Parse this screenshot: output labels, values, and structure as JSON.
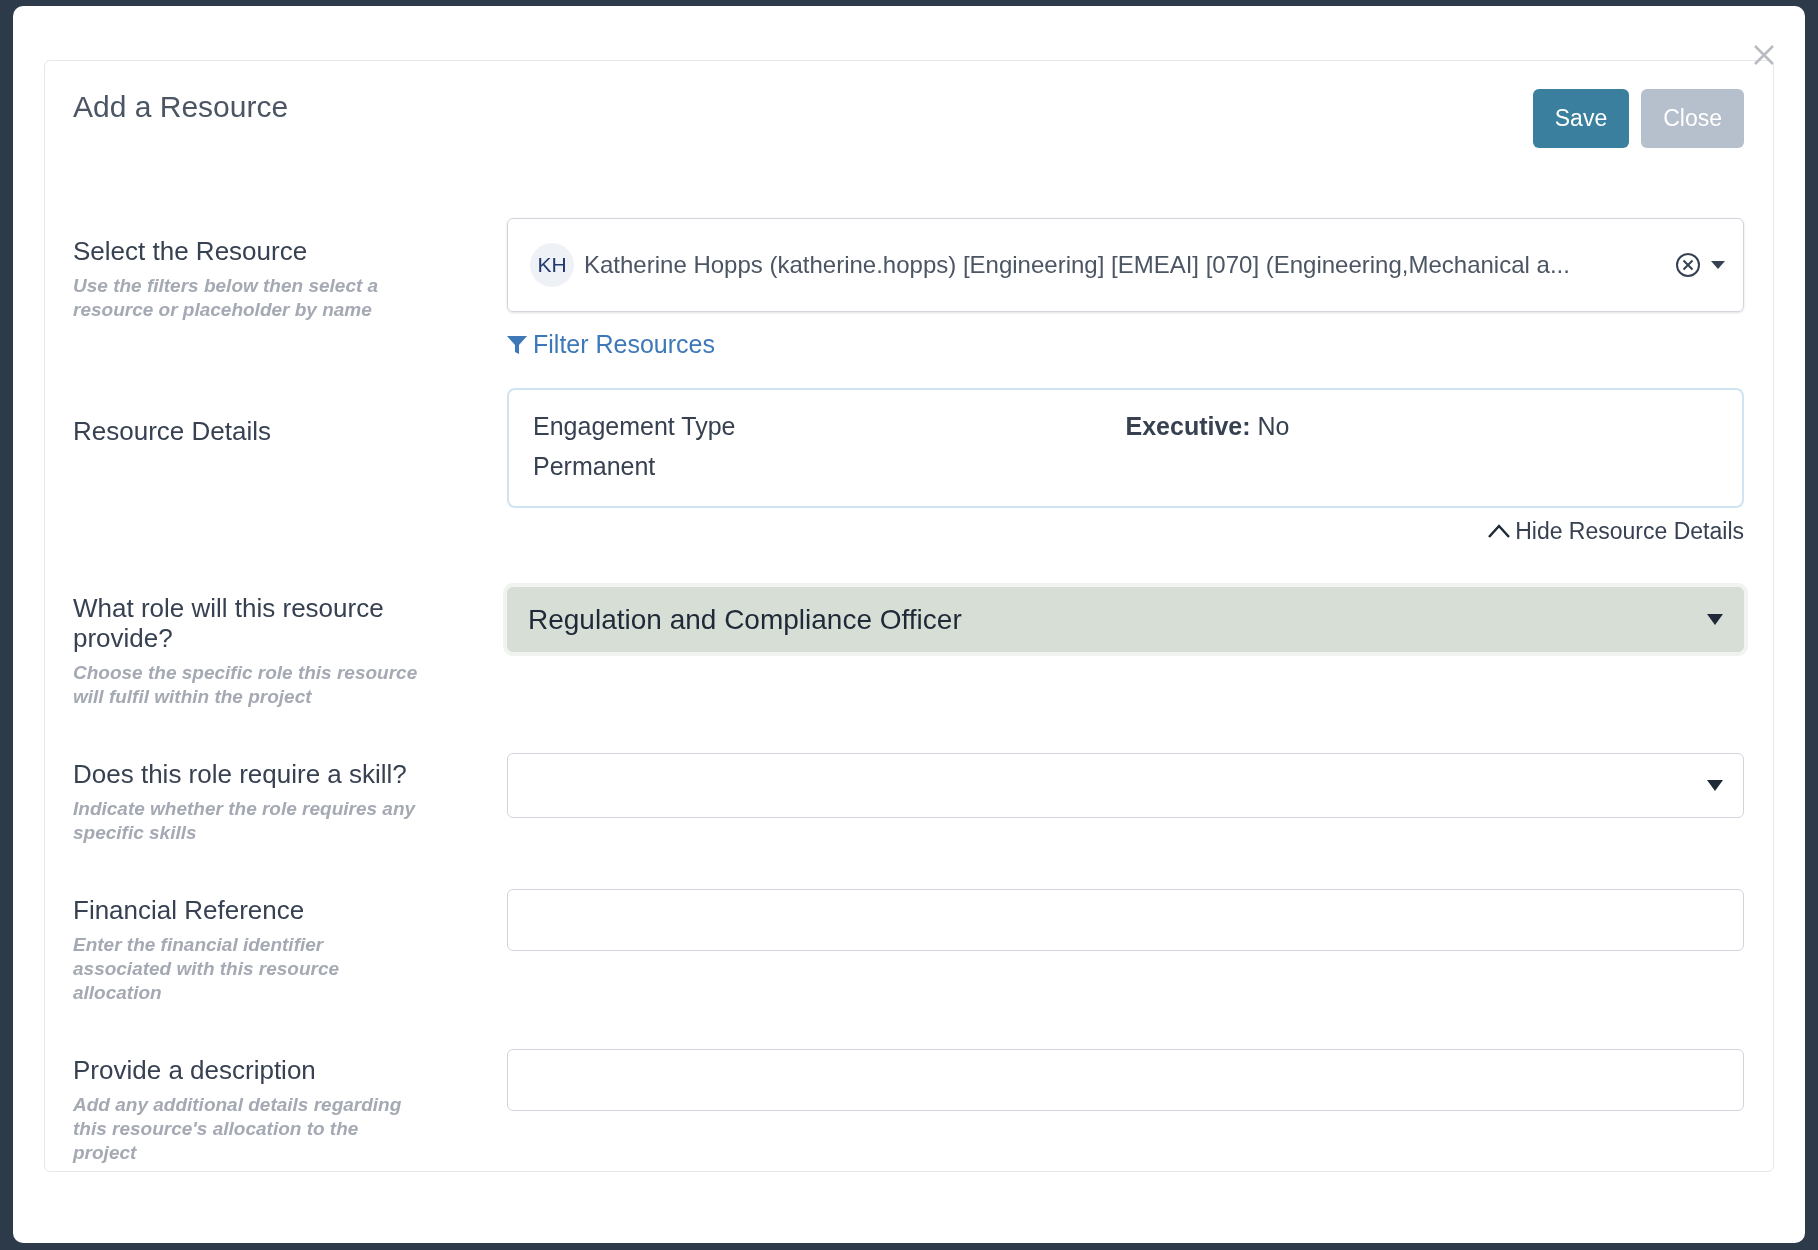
{
  "dialog": {
    "title": "Add a Resource",
    "buttons": [
      {
        "label": "Save",
        "disabled": false
      },
      {
        "label": "Close",
        "disabled": true
      }
    ]
  },
  "fields": [
    {
      "kind": "resource_select",
      "label": "Select the Resource",
      "hint": "Use the filters below then select a resource or placeholder by name",
      "initials": "KH",
      "value": "Katherine Hopps (katherine.hopps) [Engineering] [EMEAI] [070] (Engineering,Mechanical a...",
      "link": "Filter Resources"
    },
    {
      "kind": "details",
      "label": "Resource Details",
      "items": [
        {
          "name": "Engagement Type",
          "value": "Permanent",
          "inline": false
        },
        {
          "name": "Executive:",
          "value": "No",
          "inline": true
        }
      ],
      "toggle": "Hide Resource Details",
      "expanded": true
    },
    {
      "kind": "select",
      "label": "What role will this resource provide?",
      "hint": "Choose the specific role this resource will fulfil within the project",
      "value": "Regulation and Compliance Officer",
      "filled": true
    },
    {
      "kind": "select",
      "label": "Does this role require a skill?",
      "hint": "Indicate whether the role requires any specific skills",
      "filled": false
    },
    {
      "kind": "input",
      "label": "Financial Reference",
      "hint": "Enter the financial identifier associated with this resource allocation"
    },
    {
      "kind": "input",
      "label": "Provide a description",
      "hint": "Add any additional details regarding this resource's allocation to the project"
    }
  ]
}
